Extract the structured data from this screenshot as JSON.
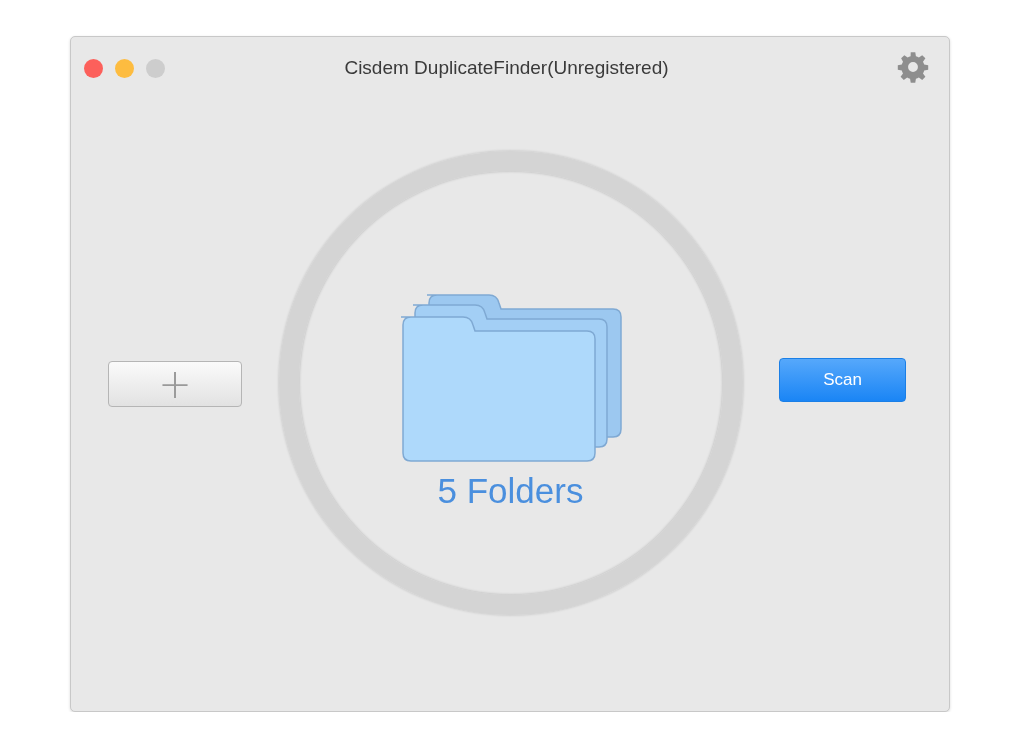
{
  "window": {
    "title": "Cisdem DuplicateFinder(Unregistered)",
    "controls": [
      {
        "color": "#fc605b"
      },
      {
        "color": "#fdbc40"
      },
      {
        "color": "#cdcdcd"
      }
    ]
  },
  "add_button": {
    "label": "+"
  },
  "folders": {
    "count_label": "5 Folders"
  },
  "scan_button": {
    "label": "Scan"
  }
}
